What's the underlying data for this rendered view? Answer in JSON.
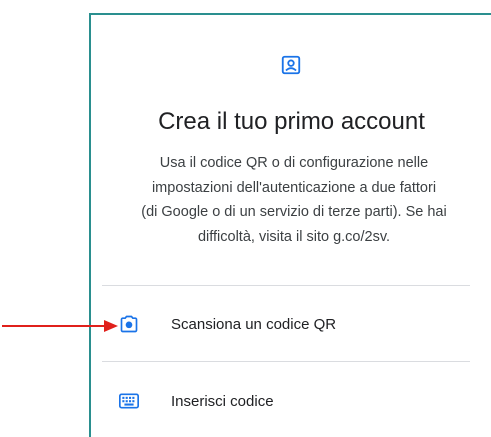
{
  "header": {
    "icon": "account-box-icon",
    "title": "Crea il tuo primo account"
  },
  "description": {
    "line1": "Usa il codice QR o di configurazione nelle",
    "line2": "impostazioni dell'autenticazione a due fattori",
    "line3": "(di Google o di un servizio di terze parti). Se hai",
    "line4": "difficoltà, visita il sito g.co/2sv."
  },
  "options": [
    {
      "icon": "camera-icon",
      "label": "Scansiona un codice QR"
    },
    {
      "icon": "keyboard-icon",
      "label": "Inserisci codice"
    }
  ],
  "annotation": {
    "icon": "red-arrow-icon"
  },
  "colors": {
    "accent": "#1a73e8",
    "frame_border": "#2a8f8f",
    "annotation_arrow": "#e0201b",
    "text_primary": "#202124",
    "text_secondary": "#3c4043",
    "divider": "#dadce0"
  }
}
